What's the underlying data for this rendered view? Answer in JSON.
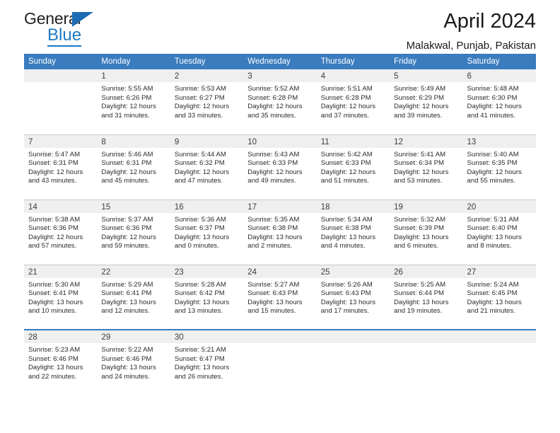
{
  "brand": {
    "name_part1": "General",
    "name_part2": "Blue",
    "triangle_icon": "blue-triangle-icon"
  },
  "header": {
    "title": "April 2024",
    "subtitle": "Malakwal, Punjab, Pakistan"
  },
  "calendar": {
    "weekday_headers": [
      "Sunday",
      "Monday",
      "Tuesday",
      "Wednesday",
      "Thursday",
      "Friday",
      "Saturday"
    ],
    "accent_color": "#3a7cbe",
    "daynum_band_color": "#efefef",
    "weeks": [
      [
        {
          "blank": true
        },
        {
          "day": "1",
          "sunrise": "Sunrise: 5:55 AM",
          "sunset": "Sunset: 6:26 PM",
          "daylight1": "Daylight: 12 hours",
          "daylight2": "and 31 minutes."
        },
        {
          "day": "2",
          "sunrise": "Sunrise: 5:53 AM",
          "sunset": "Sunset: 6:27 PM",
          "daylight1": "Daylight: 12 hours",
          "daylight2": "and 33 minutes."
        },
        {
          "day": "3",
          "sunrise": "Sunrise: 5:52 AM",
          "sunset": "Sunset: 6:28 PM",
          "daylight1": "Daylight: 12 hours",
          "daylight2": "and 35 minutes."
        },
        {
          "day": "4",
          "sunrise": "Sunrise: 5:51 AM",
          "sunset": "Sunset: 6:28 PM",
          "daylight1": "Daylight: 12 hours",
          "daylight2": "and 37 minutes."
        },
        {
          "day": "5",
          "sunrise": "Sunrise: 5:49 AM",
          "sunset": "Sunset: 6:29 PM",
          "daylight1": "Daylight: 12 hours",
          "daylight2": "and 39 minutes."
        },
        {
          "day": "6",
          "sunrise": "Sunrise: 5:48 AM",
          "sunset": "Sunset: 6:30 PM",
          "daylight1": "Daylight: 12 hours",
          "daylight2": "and 41 minutes."
        }
      ],
      [
        {
          "day": "7",
          "sunrise": "Sunrise: 5:47 AM",
          "sunset": "Sunset: 6:31 PM",
          "daylight1": "Daylight: 12 hours",
          "daylight2": "and 43 minutes."
        },
        {
          "day": "8",
          "sunrise": "Sunrise: 5:46 AM",
          "sunset": "Sunset: 6:31 PM",
          "daylight1": "Daylight: 12 hours",
          "daylight2": "and 45 minutes."
        },
        {
          "day": "9",
          "sunrise": "Sunrise: 5:44 AM",
          "sunset": "Sunset: 6:32 PM",
          "daylight1": "Daylight: 12 hours",
          "daylight2": "and 47 minutes."
        },
        {
          "day": "10",
          "sunrise": "Sunrise: 5:43 AM",
          "sunset": "Sunset: 6:33 PM",
          "daylight1": "Daylight: 12 hours",
          "daylight2": "and 49 minutes."
        },
        {
          "day": "11",
          "sunrise": "Sunrise: 5:42 AM",
          "sunset": "Sunset: 6:33 PM",
          "daylight1": "Daylight: 12 hours",
          "daylight2": "and 51 minutes."
        },
        {
          "day": "12",
          "sunrise": "Sunrise: 5:41 AM",
          "sunset": "Sunset: 6:34 PM",
          "daylight1": "Daylight: 12 hours",
          "daylight2": "and 53 minutes."
        },
        {
          "day": "13",
          "sunrise": "Sunrise: 5:40 AM",
          "sunset": "Sunset: 6:35 PM",
          "daylight1": "Daylight: 12 hours",
          "daylight2": "and 55 minutes."
        }
      ],
      [
        {
          "day": "14",
          "sunrise": "Sunrise: 5:38 AM",
          "sunset": "Sunset: 6:36 PM",
          "daylight1": "Daylight: 12 hours",
          "daylight2": "and 57 minutes."
        },
        {
          "day": "15",
          "sunrise": "Sunrise: 5:37 AM",
          "sunset": "Sunset: 6:36 PM",
          "daylight1": "Daylight: 12 hours",
          "daylight2": "and 59 minutes."
        },
        {
          "day": "16",
          "sunrise": "Sunrise: 5:36 AM",
          "sunset": "Sunset: 6:37 PM",
          "daylight1": "Daylight: 13 hours",
          "daylight2": "and 0 minutes."
        },
        {
          "day": "17",
          "sunrise": "Sunrise: 5:35 AM",
          "sunset": "Sunset: 6:38 PM",
          "daylight1": "Daylight: 13 hours",
          "daylight2": "and 2 minutes."
        },
        {
          "day": "18",
          "sunrise": "Sunrise: 5:34 AM",
          "sunset": "Sunset: 6:38 PM",
          "daylight1": "Daylight: 13 hours",
          "daylight2": "and 4 minutes."
        },
        {
          "day": "19",
          "sunrise": "Sunrise: 5:32 AM",
          "sunset": "Sunset: 6:39 PM",
          "daylight1": "Daylight: 13 hours",
          "daylight2": "and 6 minutes."
        },
        {
          "day": "20",
          "sunrise": "Sunrise: 5:31 AM",
          "sunset": "Sunset: 6:40 PM",
          "daylight1": "Daylight: 13 hours",
          "daylight2": "and 8 minutes."
        }
      ],
      [
        {
          "day": "21",
          "sunrise": "Sunrise: 5:30 AM",
          "sunset": "Sunset: 6:41 PM",
          "daylight1": "Daylight: 13 hours",
          "daylight2": "and 10 minutes."
        },
        {
          "day": "22",
          "sunrise": "Sunrise: 5:29 AM",
          "sunset": "Sunset: 6:41 PM",
          "daylight1": "Daylight: 13 hours",
          "daylight2": "and 12 minutes."
        },
        {
          "day": "23",
          "sunrise": "Sunrise: 5:28 AM",
          "sunset": "Sunset: 6:42 PM",
          "daylight1": "Daylight: 13 hours",
          "daylight2": "and 13 minutes."
        },
        {
          "day": "24",
          "sunrise": "Sunrise: 5:27 AM",
          "sunset": "Sunset: 6:43 PM",
          "daylight1": "Daylight: 13 hours",
          "daylight2": "and 15 minutes."
        },
        {
          "day": "25",
          "sunrise": "Sunrise: 5:26 AM",
          "sunset": "Sunset: 6:43 PM",
          "daylight1": "Daylight: 13 hours",
          "daylight2": "and 17 minutes."
        },
        {
          "day": "26",
          "sunrise": "Sunrise: 5:25 AM",
          "sunset": "Sunset: 6:44 PM",
          "daylight1": "Daylight: 13 hours",
          "daylight2": "and 19 minutes."
        },
        {
          "day": "27",
          "sunrise": "Sunrise: 5:24 AM",
          "sunset": "Sunset: 6:45 PM",
          "daylight1": "Daylight: 13 hours",
          "daylight2": "and 21 minutes."
        }
      ],
      [
        {
          "day": "28",
          "sunrise": "Sunrise: 5:23 AM",
          "sunset": "Sunset: 6:46 PM",
          "daylight1": "Daylight: 13 hours",
          "daylight2": "and 22 minutes."
        },
        {
          "day": "29",
          "sunrise": "Sunrise: 5:22 AM",
          "sunset": "Sunset: 6:46 PM",
          "daylight1": "Daylight: 13 hours",
          "daylight2": "and 24 minutes."
        },
        {
          "day": "30",
          "sunrise": "Sunrise: 5:21 AM",
          "sunset": "Sunset: 6:47 PM",
          "daylight1": "Daylight: 13 hours",
          "daylight2": "and 26 minutes."
        },
        {
          "blank": true
        },
        {
          "blank": true
        },
        {
          "blank": true
        },
        {
          "blank": true
        }
      ]
    ]
  }
}
